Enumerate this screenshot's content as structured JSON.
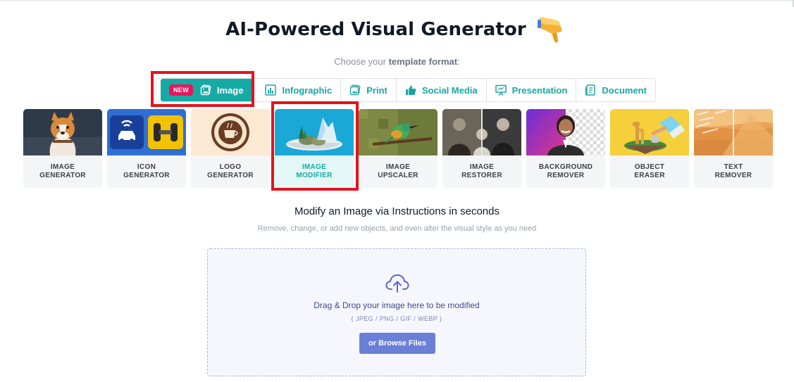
{
  "page": {
    "title": "AI-Powered Visual Generator",
    "subtitle_prefix": "Choose your ",
    "subtitle_bold": "template format",
    "subtitle_suffix": ":"
  },
  "tabs": [
    {
      "id": "image",
      "label": "Image",
      "badge": "NEW",
      "active": true,
      "icon": "image-icon"
    },
    {
      "id": "infographic",
      "label": "Infographic",
      "active": false,
      "icon": "bar-chart-icon"
    },
    {
      "id": "print",
      "label": "Print",
      "active": false,
      "icon": "print-icon"
    },
    {
      "id": "social",
      "label": "Social Media",
      "active": false,
      "icon": "thumbs-up-icon"
    },
    {
      "id": "presentation",
      "label": "Presentation",
      "active": false,
      "icon": "presentation-icon"
    },
    {
      "id": "document",
      "label": "Document",
      "active": false,
      "icon": "document-icon"
    }
  ],
  "tools": [
    {
      "line1": "IMAGE",
      "line2": "GENERATOR",
      "thumb": "corgi-thumbnail"
    },
    {
      "line1": "ICON",
      "line2": "GENERATOR",
      "thumb": "icons-thumbnail"
    },
    {
      "line1": "LOGO",
      "line2": "GENERATOR",
      "thumb": "coffee-logo-thumbnail"
    },
    {
      "line1": "IMAGE",
      "line2": "MODIFIER",
      "thumb": "glacier-bowl-thumbnail",
      "selected": true
    },
    {
      "line1": "IMAGE",
      "line2": "UPSCALER",
      "thumb": "bird-thumbnail"
    },
    {
      "line1": "IMAGE",
      "line2": "RESTORER",
      "thumb": "old-photo-thumbnail"
    },
    {
      "line1": "BACKGROUND",
      "line2": "REMOVER",
      "thumb": "portrait-thumbnail"
    },
    {
      "line1": "OBJECT",
      "line2": "ERASER",
      "thumb": "giraffe-island-thumbnail"
    },
    {
      "line1": "TEXT",
      "line2": "REMOVER",
      "thumb": "desert-dune-thumbnail"
    }
  ],
  "modifier": {
    "heading": "Modify an Image via Instructions in seconds",
    "description": "Remove, change, or add new objects, and even alter the visual style as you need",
    "drop_text": "Drag & Drop your image here to be modified",
    "formats": "( JPEG / PNG / GIF / WEBP )",
    "browse_label": "or Browse Files",
    "upload_icon": "cloud-upload-icon"
  },
  "colors": {
    "accent": "#16aaa4",
    "badge": "#e8175d",
    "highlight": "#e3131d",
    "browse": "#6b7fd7"
  }
}
